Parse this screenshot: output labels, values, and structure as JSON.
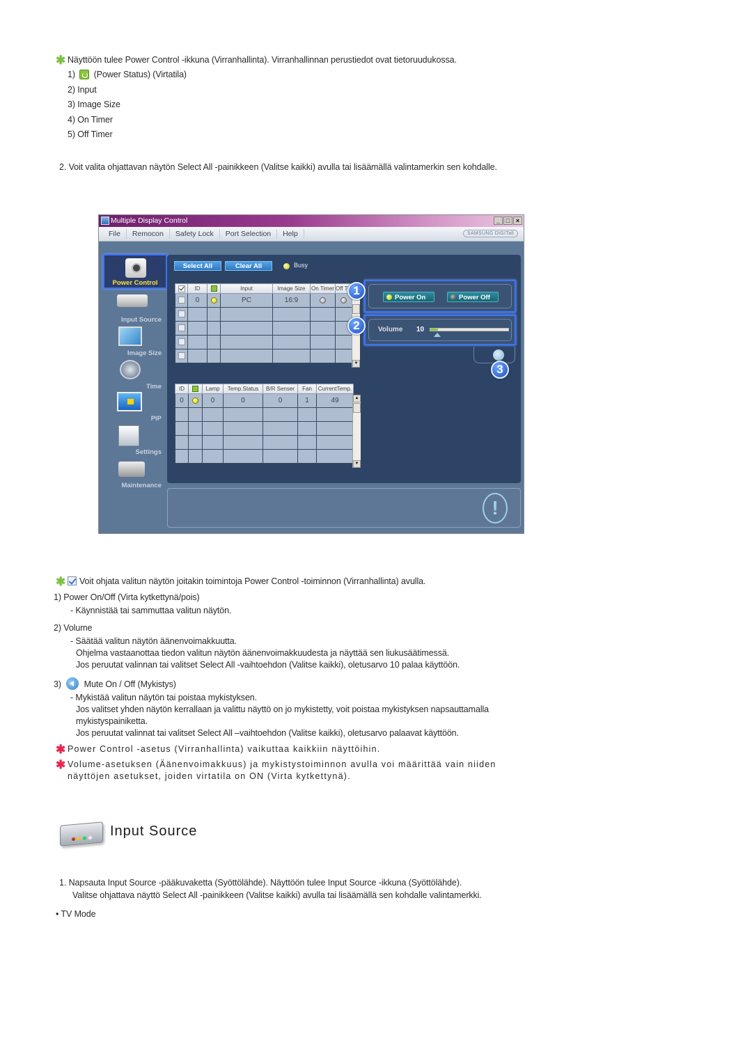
{
  "intro": {
    "note": "Näyttöön tulee Power Control -ikkuna (Virranhallinta). Virranhallinnan perustiedot ovat tietoruudukossa.",
    "items": [
      {
        "num": "1)",
        "label": "(Power Status) (Virtatila)",
        "icon": "power-status-icon"
      },
      {
        "num": "2)",
        "label": "Input"
      },
      {
        "num": "3)",
        "label": "Image Size"
      },
      {
        "num": "4)",
        "label": "On Timer"
      },
      {
        "num": "5)",
        "label": "Off Timer"
      }
    ],
    "step2": "2.  Voit valita ohjattavan näytön Select All -painikkeen (Valitse kaikki) avulla tai lisäämällä valintamerkin sen kohdalle."
  },
  "app": {
    "title": "Multiple Display Control",
    "window_buttons": [
      "_",
      "□",
      "×"
    ],
    "menu": [
      "File",
      "Remocon",
      "Safety Lock",
      "Port Selection",
      "Help"
    ],
    "brand": "SAMSUNG DIGITall",
    "sidebar": [
      {
        "label": "Power Control",
        "active": true
      },
      {
        "label": "Input Source"
      },
      {
        "label": "Image Size"
      },
      {
        "label": "Time"
      },
      {
        "label": "PIP"
      },
      {
        "label": "Settings"
      },
      {
        "label": "Maintenance"
      }
    ],
    "toolbar": {
      "select_all": "Select All",
      "clear_all": "Clear All",
      "busy": "Busy"
    },
    "top_table": {
      "headers": [
        "",
        "ID",
        "",
        "Input",
        "Image Size",
        "On Timer",
        "Off Timer"
      ],
      "rows": [
        {
          "checked": false,
          "id": "0",
          "power": "on",
          "input": "PC",
          "image_size": "16:9",
          "on_timer": "off",
          "off_timer": "off"
        },
        {
          "checked": false,
          "id": "",
          "input": "",
          "image_size": ""
        },
        {
          "checked": false,
          "id": "",
          "input": "",
          "image_size": ""
        },
        {
          "checked": false,
          "id": "",
          "input": "",
          "image_size": ""
        },
        {
          "checked": false,
          "id": "",
          "input": "",
          "image_size": ""
        }
      ]
    },
    "bottom_table": {
      "headers": [
        "ID",
        "",
        "Lamp",
        "Temp.Status",
        "B/R Senser",
        "Fan",
        "CurrentTemp."
      ],
      "rows": [
        {
          "id": "0",
          "power": "on",
          "lamp": "0",
          "temp_status": "0",
          "br_sensor": "0",
          "fan": "1",
          "current_temp": "49"
        },
        {},
        {},
        {},
        {}
      ]
    },
    "power_panel": {
      "badge": "1",
      "power_on": "Power On",
      "power_off": "Power Off"
    },
    "volume_panel": {
      "badge": "2",
      "label": "Volume",
      "value": "10",
      "level_percent": 10
    },
    "mute": {
      "badge": "3"
    }
  },
  "details": {
    "note": "Voit ohjata valitun näytön joitakin toimintoja Power Control -toiminnon (Virranhallinta) avulla.",
    "item1_title": "1)  Power On/Off (Virta kytkettynä/pois)",
    "item1_desc": "- Käynnistää tai sammuttaa valitun näytön.",
    "item2_title": "2)  Volume",
    "item2_desc1": "- Säätää valitun näytön äänenvoimakkuutta.",
    "item2_desc2": "Ohjelma vastaanottaa tiedon valitun näytön äänenvoimakkuudesta ja näyttää sen liukusäätimessä.",
    "item2_desc3": "Jos peruutat valinnan tai valitset Select All -vaihtoehdon (Valitse kaikki), oletusarvo 10 palaa käyttöön.",
    "item3_num": "3)",
    "item3_title": "Mute On / Off (Mykistys)",
    "item3_desc1": "- Mykistää valitun näytön tai poistaa mykistyksen.",
    "item3_desc2": "Jos valitset yhden näytön kerrallaan ja valittu näyttö on jo mykistetty, voit poistaa mykistyksen napsauttamalla",
    "item3_desc3": "mykistyspainiketta.",
    "item3_desc4": "Jos peruutat valinnat tai valitset Select All –vaihtoehdon (Valitse kaikki), oletusarvo palaavat käyttöön.",
    "warn1": "Power Control -asetus (Virranhallinta) vaikuttaa kaikkiin näyttöihin.",
    "warn2a": "Volume-asetuksen (Äänenvoimakkuus) ja mykistystoiminnon avulla voi määrittää vain niiden",
    "warn2b": "näyttöjen asetukset, joiden virtatila on ON (Virta kytkettynä)."
  },
  "input_source": {
    "title": "Input Source",
    "step1a": "1.  Napsauta Input Source -pääkuvaketta (Syöttölähde). Näyttöön tulee Input Source -ikkuna (Syöttölähde).",
    "step1b": "Valitse ohjattava näyttö Select All -painikkeen (Valitse kaikki) avulla tai lisäämällä sen kohdalle valintamerkki.",
    "bullet": "• TV Mode"
  }
}
